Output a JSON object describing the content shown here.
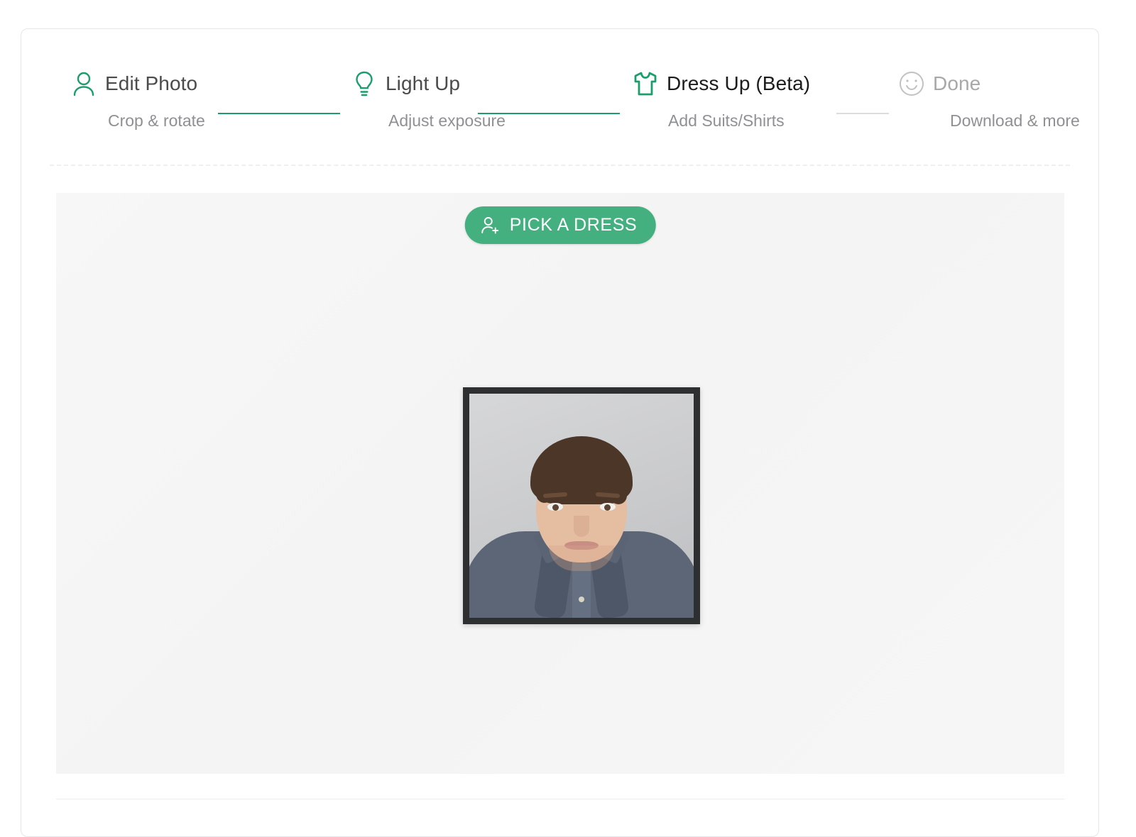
{
  "stepper": {
    "steps": [
      {
        "label": "Edit Photo",
        "sublabel": "Crop & rotate",
        "icon": "person-icon",
        "state": "done"
      },
      {
        "label": "Light Up",
        "sublabel": "Adjust exposure",
        "icon": "lightbulb-icon",
        "state": "done"
      },
      {
        "label": "Dress Up (Beta)",
        "sublabel": "Add Suits/Shirts",
        "icon": "tshirt-icon",
        "state": "active"
      },
      {
        "label": "Done",
        "sublabel": "Download & more",
        "icon": "smiley-face-icon",
        "state": "pending"
      }
    ]
  },
  "editor": {
    "pick_dress_label": "PICK A DRESS",
    "pick_dress_icon": "person-add-icon",
    "photo_alt": "passport-photo-preview"
  },
  "colors": {
    "accent_green": "#1c9e6c",
    "button_green": "#45b07f",
    "connector_gray": "#dcdcdc",
    "label_active": "#1c1c1c",
    "label_pending": "#a8a8a8",
    "sublabel_gray": "#8e9093",
    "canvas_bg": "#f5f5f5",
    "photo_frame": "#2e2f31"
  }
}
